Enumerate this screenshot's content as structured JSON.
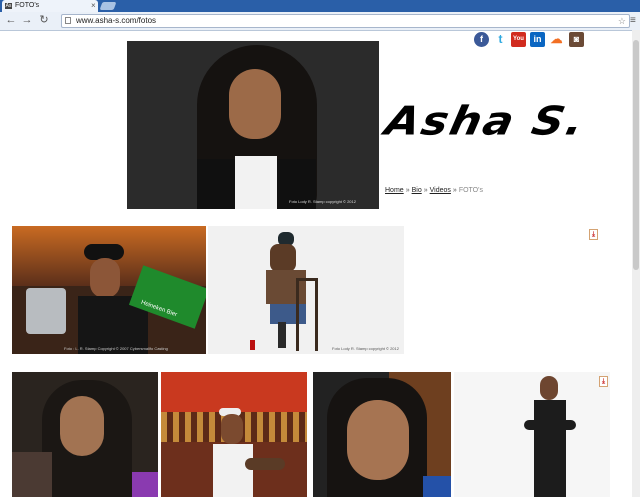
{
  "browser": {
    "tab_title": "FOTO's",
    "tab_favicon": "As",
    "tab_close": "×",
    "url": "www.asha-s.com/fotos",
    "back_icon": "arrow-left-icon",
    "forward_icon": "arrow-right-icon",
    "reload_icon": "reload-icon"
  },
  "social": [
    {
      "name": "facebook",
      "glyph": "f",
      "color": "#3b5998"
    },
    {
      "name": "twitter",
      "glyph": "t",
      "color": "#2fa9e0"
    },
    {
      "name": "youtube",
      "glyph": "You",
      "color": "#d12b1f"
    },
    {
      "name": "linkedin",
      "glyph": "in",
      "color": "#0a66c2"
    },
    {
      "name": "soundcloud",
      "glyph": "☁",
      "color": "#f26f23"
    },
    {
      "name": "instagram",
      "glyph": "◙",
      "color": "#6b4a36"
    }
  ],
  "hero": {
    "credit": "Foto Lody R. Stamp copyright © 2012"
  },
  "logo": "Asha S.",
  "nav": {
    "home": "Home",
    "bio": "Bio",
    "videos": "Videos",
    "fotos": "FOTO's",
    "separator": "»"
  },
  "photos": {
    "p1_caption": "Foto : L. R. Stamp Copyright © 2007 Cybersmallfo Casting",
    "p1_sign": "Heineken Bier",
    "p2_caption": "Foto Lody R. Stamp copyright © 2012"
  }
}
